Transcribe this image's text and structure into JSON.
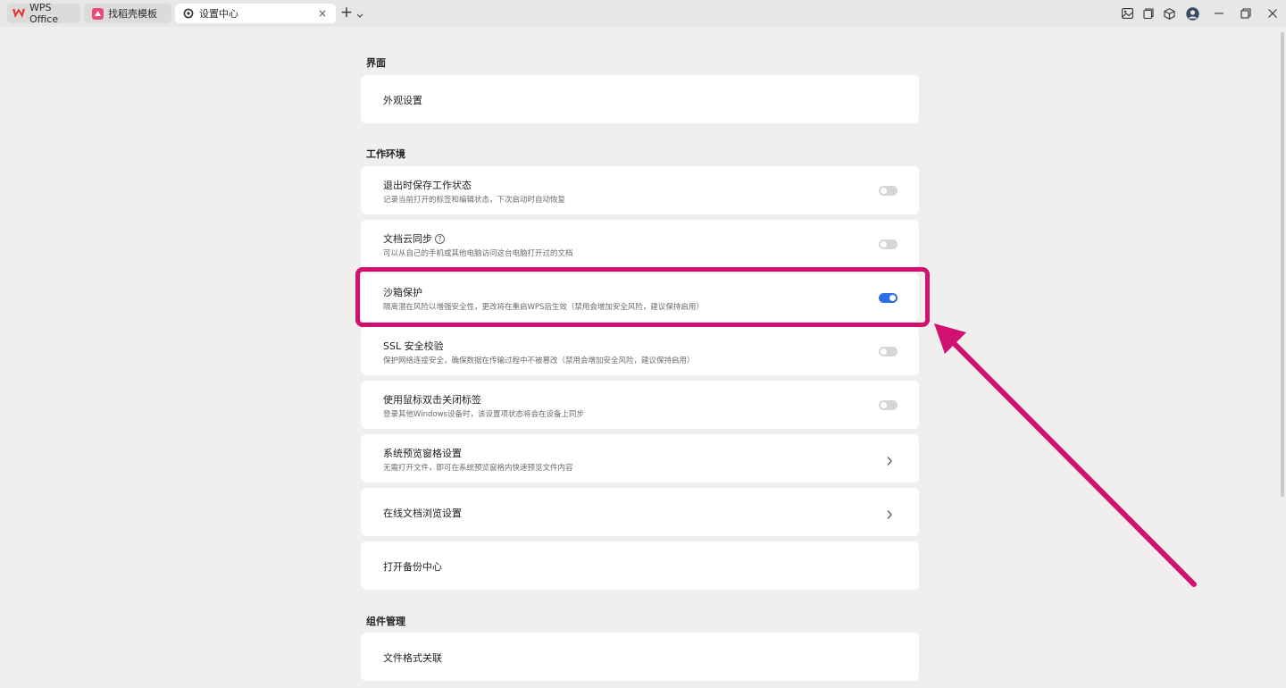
{
  "tabs": [
    {
      "label": "WPS Office",
      "icon": "wps-logo-icon"
    },
    {
      "label": "找稻壳模板",
      "icon": "template-icon"
    },
    {
      "label": "设置中心",
      "icon": "settings-gear-icon"
    }
  ],
  "tab_close": "×",
  "new_tab": "+",
  "sections": {
    "interface": "界面",
    "workspace": "工作环境",
    "components": "组件管理"
  },
  "cards": {
    "appearance": {
      "title": "外观设置"
    },
    "save_state": {
      "title": "退出时保存工作状态",
      "desc": "记录当前打开的标签和编辑状态，下次启动时自动恢复",
      "enabled": false
    },
    "cloud_sync": {
      "title": "文档云同步",
      "desc": "可以从自己的手机或其他电脑访问这台电脑打开过的文档",
      "enabled": false,
      "help": "?"
    },
    "sandbox": {
      "title": "沙箱保护",
      "desc": "隔离潜在风险以增强安全性，更改将在重启WPS后生效（禁用会增加安全风险，建议保持启用）",
      "enabled": true
    },
    "ssl": {
      "title": "SSL 安全校验",
      "desc": "保护网络连接安全，确保数据在传输过程中不被篡改（禁用会增加安全风险，建议保持启用）",
      "enabled": false
    },
    "dblclick": {
      "title": "使用鼠标双击关闭标签",
      "desc": "登录其他Windows设备时，该设置项状态将会在设备上同步",
      "enabled": false
    },
    "preview": {
      "title": "系统预览窗格设置",
      "desc": "无需打开文件，即可在系统预览窗格内快速预览文件内容"
    },
    "online_browse": {
      "title": "在线文档浏览设置"
    },
    "backup": {
      "title": "打开备份中心"
    },
    "file_assoc": {
      "title": "文件格式关联"
    }
  },
  "colors": {
    "accent": "#2f6ee6",
    "highlight": "#d1116f",
    "toggle_off": "#d6d6d6"
  }
}
